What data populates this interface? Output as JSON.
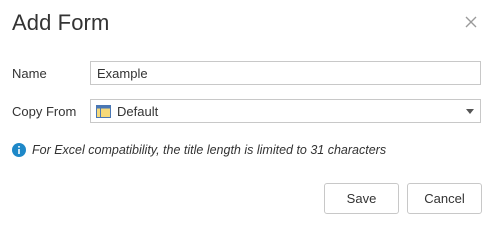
{
  "dialog": {
    "title": "Add Form",
    "close_icon": "close-icon"
  },
  "fields": {
    "name": {
      "label": "Name",
      "value": "Example",
      "placeholder": ""
    },
    "copy_from": {
      "label": "Copy From",
      "selected": "Default",
      "icon": "form-icon"
    }
  },
  "info": {
    "icon": "info-icon",
    "text": "For Excel compatibility, the title length is limited to 31 characters"
  },
  "buttons": {
    "save": "Save",
    "cancel": "Cancel"
  },
  "colors": {
    "info_blue": "#1e88c8",
    "border": "#c8c8c8",
    "form_icon_yellow": "#f5d97a",
    "form_icon_blue": "#4a77b4"
  }
}
